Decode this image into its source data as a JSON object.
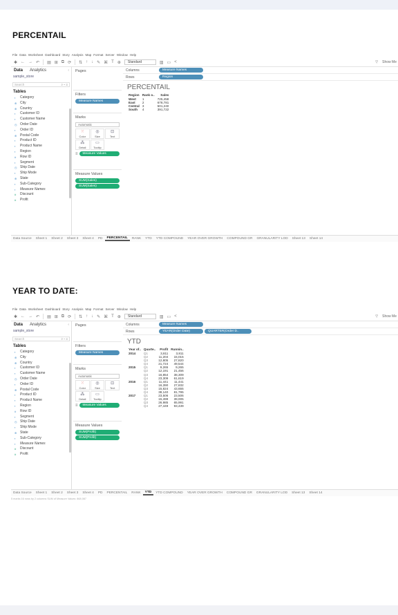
{
  "sections": [
    {
      "heading": "PERCENTAIL",
      "menu": [
        "File",
        "Data",
        "Worksheet",
        "Dashboard",
        "Story",
        "Analysis",
        "Map",
        "Format",
        "Server",
        "Window",
        "Help"
      ],
      "toolbar": {
        "fit": "Standard",
        "show_me": "Show Me"
      },
      "data_pane": {
        "tab_data": "Data",
        "tab_analytics": "Analytics",
        "source": "sample_store",
        "search_placeholder": "Search",
        "tables_label": "Tables"
      },
      "pages_label": "Pages",
      "filters_label": "Filters",
      "filters": [
        "Measure Names"
      ],
      "marks_label": "Marks",
      "marks_type": "Automatic",
      "marks_buttons": [
        "Color",
        "Size",
        "Text",
        "Detail",
        "Tooltip"
      ],
      "marks_pill": "Measure Values",
      "measure_values_label": "Measure Values",
      "measure_values": [
        "SUM(Sales)",
        "SUM(Sales)"
      ],
      "columns_label": "Columns",
      "columns": [
        "Measure Names"
      ],
      "rows_label": "Rows",
      "rows": [
        "Region"
      ],
      "view_title": "PERCENTAIL",
      "table": {
        "headers": [
          "Region",
          "Rank o..",
          "Sales"
        ],
        "rows": [
          [
            "West",
            "1",
            "725,458"
          ],
          [
            "East",
            "2",
            "678,781"
          ],
          [
            "Central",
            "3",
            "501,240"
          ],
          [
            "South",
            "4",
            "391,722"
          ]
        ]
      },
      "sheet_tabs": [
        "Data Source",
        "Sheet 1",
        "Sheet 2",
        "Sheet 3",
        "Sheet 4",
        "PD",
        "PERCENTAIL",
        "RANK",
        "YTD",
        "YTD COMPOUND",
        "YEAR OVER GROWTH",
        "COMPOUND GR",
        "GRANULARITY LOD",
        "Sheet 13",
        "Sheet 14"
      ],
      "active_tab": "PERCENTAIL"
    },
    {
      "heading": "YEAR TO DATE:",
      "menu": [
        "File",
        "Data",
        "Worksheet",
        "Dashboard",
        "Story",
        "Analysis",
        "Map",
        "Format",
        "Server",
        "Window",
        "Help"
      ],
      "toolbar": {
        "fit": "Standard",
        "show_me": "Show Me"
      },
      "data_pane": {
        "tab_data": "Data",
        "tab_analytics": "Analytics",
        "source": "sample_store",
        "search_placeholder": "Search",
        "tables_label": "Tables"
      },
      "pages_label": "Pages",
      "filters_label": "Filters",
      "filters": [
        "Measure Names"
      ],
      "marks_label": "Marks",
      "marks_type": "Automatic",
      "marks_buttons": [
        "Color",
        "Size",
        "Text",
        "Detail",
        "Tooltip"
      ],
      "marks_pill": "Measure Values",
      "measure_values_label": "Measure Values",
      "measure_values": [
        "SUM(Profit)",
        "SUM(Profit)"
      ],
      "columns_label": "Columns",
      "columns": [
        "Measure Names"
      ],
      "rows_label": "Rows",
      "rows": [
        "YEAR(Order Date)",
        "QUARTER(Order D.."
      ],
      "view_title": "YTD",
      "table": {
        "headers": [
          "Year of..",
          "Quarte..",
          "Profit",
          "Runnin.."
        ],
        "rows": [
          [
            "2014",
            "Q1",
            "3,811",
            "3,811"
          ],
          [
            "",
            "Q2",
            "11,204",
            "15,015"
          ],
          [
            "",
            "Q3",
            "12,805",
            "27,820"
          ],
          [
            "",
            "Q4",
            "21,724",
            "49,544"
          ],
          [
            "2015",
            "Q1",
            "9,265",
            "9,265"
          ],
          [
            "",
            "Q2",
            "12,191",
            "21,456"
          ],
          [
            "",
            "Q3",
            "16,854",
            "38,309"
          ],
          [
            "",
            "Q4",
            "23,309",
            "61,619"
          ],
          [
            "2016",
            "Q1",
            "11,441",
            "11,441"
          ],
          [
            "",
            "Q2",
            "16,390",
            "27,832"
          ],
          [
            "",
            "Q3",
            "15,824",
            "43,655"
          ],
          [
            "",
            "Q4",
            "38,140",
            "81,795"
          ],
          [
            "2017",
            "Q1",
            "23,506",
            "23,506"
          ],
          [
            "",
            "Q2",
            "15,499",
            "39,005"
          ],
          [
            "",
            "Q3",
            "26,985",
            "65,991"
          ],
          [
            "",
            "Q4",
            "27,449",
            "93,439"
          ]
        ]
      },
      "sheet_tabs": [
        "Data Source",
        "Sheet 1",
        "Sheet 2",
        "Sheet 3",
        "Sheet 4",
        "PD",
        "PERCENTAIL",
        "RANK",
        "YTD",
        "YTD COMPOUND",
        "YEAR OVER GROWTH",
        "COMPOUND GR",
        "GRANULARITY LOD",
        "Sheet 13",
        "Sheet 14"
      ],
      "active_tab": "YTD",
      "status": "5 marks   16 rows by 2 columns   SUM of Measure Values: 868,087"
    }
  ],
  "fields": [
    {
      "name": "Category",
      "kind": "dim"
    },
    {
      "name": "City",
      "kind": "geo"
    },
    {
      "name": "Country",
      "kind": "geo"
    },
    {
      "name": "Customer ID",
      "kind": "dim"
    },
    {
      "name": "Customer Name",
      "kind": "dim"
    },
    {
      "name": "Order Date",
      "kind": "date"
    },
    {
      "name": "Order ID",
      "kind": "dim"
    },
    {
      "name": "Postal Code",
      "kind": "geo"
    },
    {
      "name": "Product ID",
      "kind": "dim"
    },
    {
      "name": "Product Name",
      "kind": "dim"
    },
    {
      "name": "Region",
      "kind": "dim"
    },
    {
      "name": "Row ID",
      "kind": "num"
    },
    {
      "name": "Segment",
      "kind": "dim"
    },
    {
      "name": "Ship Date",
      "kind": "date"
    },
    {
      "name": "Ship Mode",
      "kind": "dim"
    },
    {
      "name": "State",
      "kind": "geo"
    },
    {
      "name": "Sub-Category",
      "kind": "dim"
    },
    {
      "name": "Measure Names",
      "kind": "dim",
      "italic": true
    },
    {
      "name": "Discount",
      "kind": "mea"
    },
    {
      "name": "Profit",
      "kind": "mea"
    }
  ],
  "colors": {
    "dimension_pill": "#4d8fb8",
    "measure_pill": "#1fad74"
  }
}
